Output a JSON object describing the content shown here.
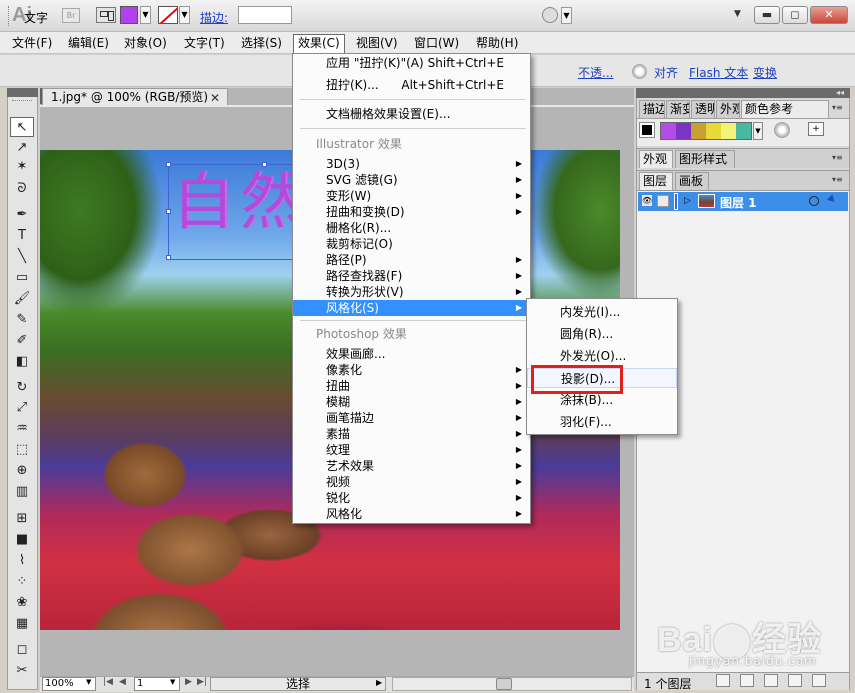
{
  "titlebar": {
    "logo": "Ai",
    "br_label": "Br",
    "arrange_arrow": "▼",
    "search_arrow": "▼",
    "min": "▬",
    "max": "◻",
    "close": "✕"
  },
  "menubar": {
    "items": [
      "文件(F)",
      "编辑(E)",
      "对象(O)",
      "文字(T)",
      "选择(S)",
      "效果(C)",
      "视图(V)",
      "窗口(W)",
      "帮助(H)"
    ]
  },
  "control": {
    "label": "文字",
    "fill_color": "#b040f0",
    "dd": "▼",
    "stroke_link": "描边:",
    "opacity_link": "不透...",
    "align_link": "对齐",
    "flash_link": "Flash 文本",
    "transform_link": "变换"
  },
  "document": {
    "tab_title": "1.jpg* @ 100% (RGB/预览)",
    "close": "✕"
  },
  "status": {
    "zoom": "100%",
    "page": "1",
    "mode": "选择",
    "first": "|◀",
    "prev": "◀",
    "next": "▶",
    "last": "▶|",
    "dd": "▼",
    "arrow": "▶"
  },
  "tools": {
    "icons": [
      "selection-tool-icon",
      "direct-selection-tool-icon",
      "magic-wand-tool-icon",
      "lasso-tool-icon",
      "pen-tool-icon",
      "type-tool-icon",
      "line-tool-icon",
      "rectangle-tool-icon",
      "paintbrush-tool-icon",
      "pencil-tool-icon",
      "blob-brush-tool-icon",
      "eraser-tool-icon",
      "rotate-tool-icon",
      "scale-tool-icon",
      "warp-tool-icon",
      "free-transform-tool-icon",
      "shape-builder-tool-icon",
      "graph-tool-icon",
      "mesh-tool-icon",
      "gradient-tool-icon",
      "eyedropper-tool-icon",
      "blend-tool-icon",
      "symbol-sprayer-tool-icon",
      "column-graph-tool-icon",
      "artboard-tool-icon",
      "slice-tool-icon"
    ],
    "glyphs": [
      "↖",
      "↗",
      "✶",
      "ᘐ",
      "✒",
      "T",
      "╲",
      "▭",
      "🖌",
      "✎",
      "✐",
      "◧",
      "↻",
      "⤢",
      "♒",
      "⬚",
      "⊕",
      "▥",
      "⊞",
      "■",
      "⌇",
      "⁘",
      "❀",
      "▦",
      "◻",
      "✂"
    ]
  },
  "effect_menu": {
    "apply_last": {
      "label": "应用 \"扭拧(K)\"(A)",
      "shortcut": "Shift+Ctrl+E"
    },
    "last": {
      "label": "扭拧(K)...",
      "shortcut": "Alt+Shift+Ctrl+E"
    },
    "raster_settings": "文档栅格效果设置(E)...",
    "illustrator_header": "Illustrator 效果",
    "illustrator_items": [
      "3D(3)",
      "SVG 滤镜(G)",
      "变形(W)",
      "扭曲和变换(D)",
      "栅格化(R)...",
      "裁剪标记(O)",
      "路径(P)",
      "路径查找器(F)",
      "转换为形状(V)",
      "风格化(S)"
    ],
    "photoshop_header": "Photoshop 效果",
    "photoshop_items": [
      "效果画廊...",
      "像素化",
      "扭曲",
      "模糊",
      "画笔描边",
      "素描",
      "纹理",
      "艺术效果",
      "视频",
      "锐化",
      "风格化"
    ],
    "arrow": "▶"
  },
  "stylize_submenu": {
    "items": [
      "内发光(I)...",
      "圆角(R)...",
      "外发光(O)...",
      "投影(D)...",
      "涂抹(B)...",
      "羽化(F)..."
    ],
    "highlight_color": "#e0201a"
  },
  "right_panel": {
    "tabs_top": [
      "描边",
      "渐变",
      "透明",
      "外观",
      "颜色参考"
    ],
    "colorref_swatches": [
      "#b34de6",
      "#7a35c8",
      "#c8a032",
      "#e8d838",
      "#f2f27a",
      "#48b8a0"
    ],
    "tabs_mid": [
      "外观",
      "图形样式"
    ],
    "tabs_layers": [
      "图层",
      "画板"
    ],
    "layer_name": "图层 1",
    "layers_count": "1 个图层",
    "menu_glyph": "▾≡",
    "grip": "◂◂",
    "save_glyph": "+",
    "eye": "👁",
    "expand": "▷"
  },
  "artwork": {
    "text": "自然"
  },
  "watermark": {
    "logo": "Bai⬤经验",
    "url": "jingyan.baidu.com"
  }
}
